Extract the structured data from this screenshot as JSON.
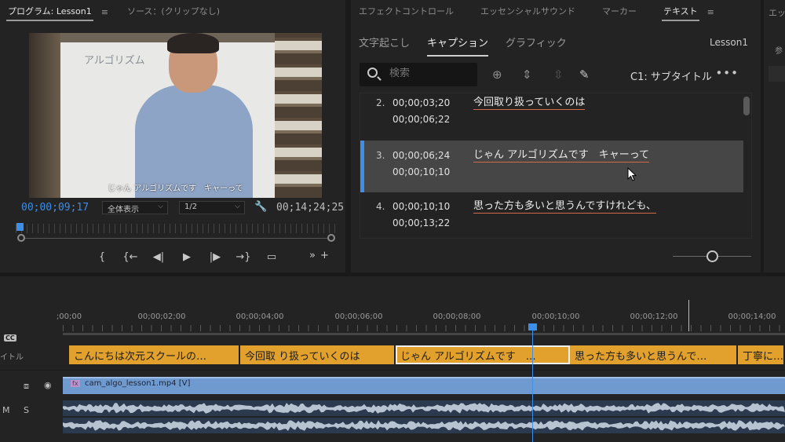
{
  "program": {
    "tab_label": "プログラム: Lesson1",
    "menu_icon": "≡",
    "source_tab": "ソース：(クリップなし)",
    "video_board_text": "アルゴリズム",
    "video_subtitle": "じゃん アルゴリズムです　キャーって",
    "timecode_current": "00;00;09;17",
    "zoom_value": "全体表示",
    "resolution_value": "1/2",
    "timecode_duration": "00;14;24;25",
    "transport": [
      "{",
      "{←",
      "◀|",
      "▶",
      "|▶",
      "→}",
      "▭"
    ],
    "tail": [
      "»",
      "+"
    ]
  },
  "effects": {
    "tabs": [
      "エフェクトコントロール",
      "エッセンシャルサウンド",
      "マーカー",
      "テキスト"
    ],
    "active_tab": "テキスト",
    "subtabs": [
      "文字起こし",
      "キャプション",
      "グラフィック"
    ],
    "active_subtab": "キャプション",
    "project": "Lesson1",
    "search_placeholder": "検索",
    "caption_track": "C1: サブタイトル",
    "more": "•••"
  },
  "captions": [
    {
      "num": "2.",
      "in": "00;00;03;20",
      "out": "00;00;06;22",
      "text": "今回取り扱っていくのは",
      "selected": false
    },
    {
      "num": "3.",
      "in": "00;00;06;24",
      "out": "00;00;10;10",
      "text": "じゃん アルゴリズムです　キャーって",
      "selected": true
    },
    {
      "num": "4.",
      "in": "00;00;10;10",
      "out": "00;00;13;22",
      "text": "思った方も多いと思うんですけれども、",
      "selected": false
    }
  ],
  "right_panel": {
    "tab": "エッ",
    "sub": "参"
  },
  "timeline": {
    "ruler_labels": [
      ";00;00",
      "00;00;02;00",
      "00;00;04;00",
      "00;00;06;00",
      "00;00;08;00",
      "00;00;10;00",
      "00;00;12;00",
      "00;00;14;00"
    ],
    "cc_label": "CC",
    "subtitle_track_label": "イトル",
    "caption_clips": [
      "こんにちは次元スクールの…",
      "今回取 り扱っていくのは",
      "じゃん アルゴリズムです　…",
      "思った方も多いと思うんで…",
      "丁寧に…"
    ],
    "video_clip_name": "cam_algo_lesson1.mp4 [V]",
    "fx_badge": "fx",
    "audio_track_m": "M",
    "audio_track_s": "S",
    "colors": {
      "accent": "#3d8ee8",
      "caption_clip": "#e1a12c",
      "video_clip": "#6f9ad0",
      "audio_clip": "#2c3a4f"
    }
  }
}
